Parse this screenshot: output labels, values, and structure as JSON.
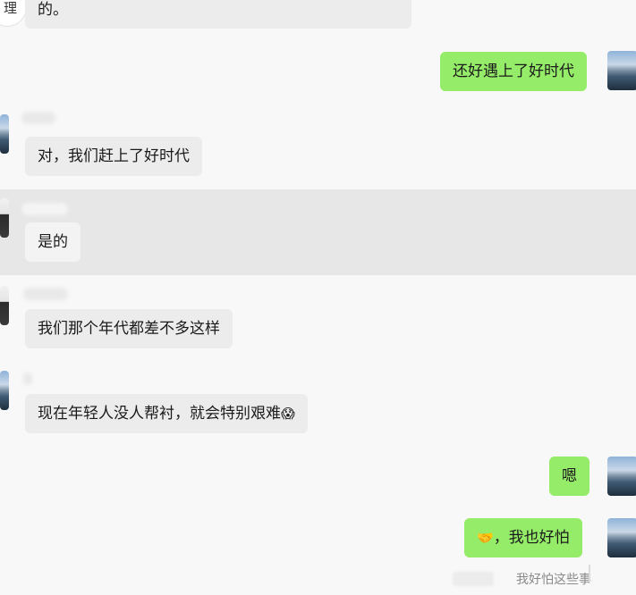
{
  "messages": [
    {
      "side": "in",
      "text": "的。"
    },
    {
      "side": "out",
      "text": "还好遇上了好时代"
    },
    {
      "side": "in",
      "text": "对，我们赶上了好时代"
    },
    {
      "side": "in",
      "text": "是的"
    },
    {
      "side": "in",
      "text": "我们那个年代都差不多这样"
    },
    {
      "side": "in",
      "text": "现在年轻人没人帮衬，就会特别艰难",
      "emoji": "😱"
    },
    {
      "side": "out",
      "text": "嗯"
    },
    {
      "side": "out",
      "text": "，我也好怕",
      "emoji": "🤝"
    }
  ],
  "quote": {
    "text": "我好怕这些事"
  },
  "edge_button": {
    "label": "理"
  },
  "colors": {
    "incoming": "#ececec",
    "outgoing": "#95ec69",
    "highlight": "#e7e7e7"
  }
}
